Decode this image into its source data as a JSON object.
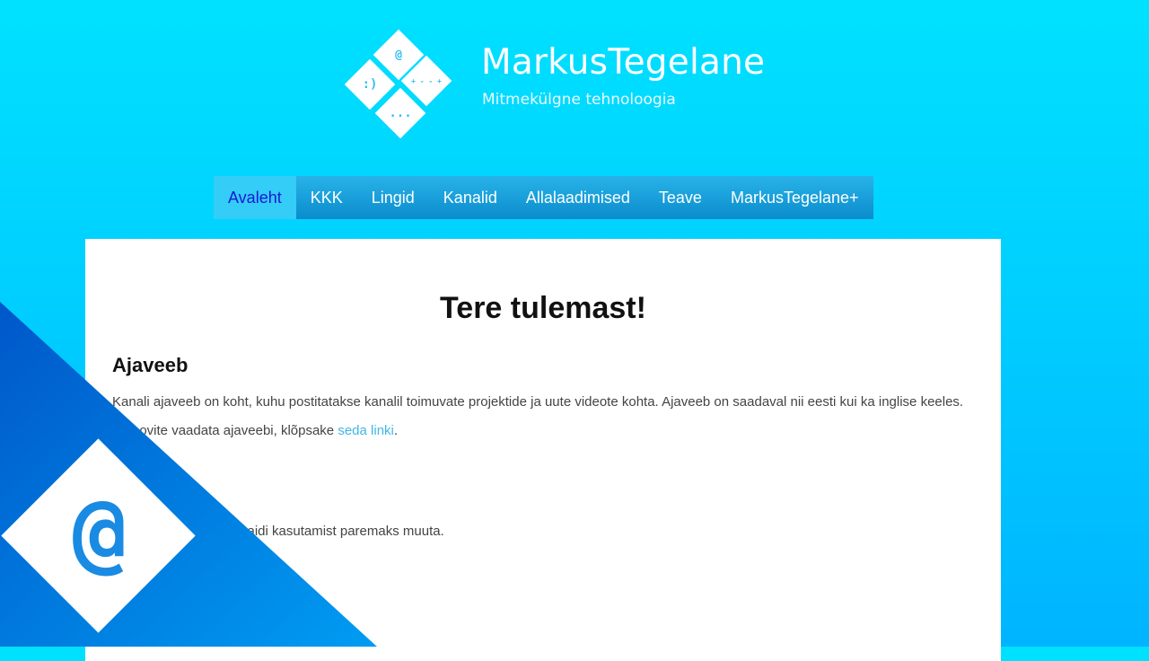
{
  "header": {
    "title": "MarkusTegelane",
    "subtitle": "Mitmekülgne tehnoloogia",
    "logo_glyphs": {
      "top": "@",
      "left": ":)",
      "right": "+ - - +",
      "bottom": "..."
    }
  },
  "nav": {
    "items": [
      {
        "label": "Avaleht",
        "active": true
      },
      {
        "label": "KKK"
      },
      {
        "label": "Lingid"
      },
      {
        "label": "Kanalid"
      },
      {
        "label": "Allalaadimised"
      },
      {
        "label": "Teave"
      },
      {
        "label": "MarkusTegelane+"
      }
    ]
  },
  "content": {
    "heading": "Tere tulemast!",
    "section_title": "Ajaveeb",
    "paragraph1": "Kanali ajaveeb on koht, kuhu postitatakse kanalil toimuvate projektide ja uute videote kohta. Ajaveeb on saadaval nii eesti kui ka inglise keeles.",
    "paragraph2_prefix": "oovite vaadata ajaveebi, klõpsake ",
    "paragraph2_link": "seda linki",
    "paragraph2_suffix": ".",
    "paragraph3": "saidi kasutamist paremaks muuta."
  },
  "overlay": {
    "at_glyph": "@"
  },
  "colors": {
    "bg_top": "#00e1ff",
    "bg_bottom": "#00b4ff",
    "nav_active_text": "#1a18d6",
    "link": "#3fb7e8",
    "overlay_dark": "#0057c9",
    "overlay_light": "#009cf2"
  }
}
